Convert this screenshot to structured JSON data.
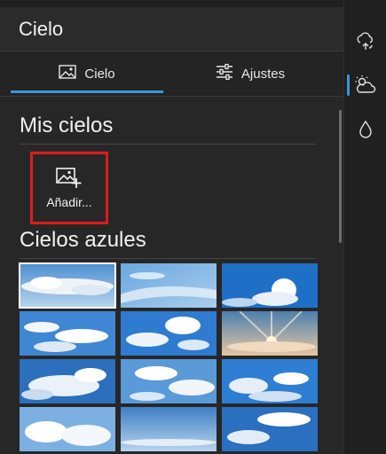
{
  "panel": {
    "title": "Cielo"
  },
  "tabs": [
    {
      "label": "Cielo",
      "icon": "image-icon",
      "active": true
    },
    {
      "label": "Ajustes",
      "icon": "sliders-icon",
      "active": false
    }
  ],
  "my_skies": {
    "title": "Mis cielos",
    "add_label": "Añadir..."
  },
  "blue_skies": {
    "title": "Cielos azules"
  },
  "rail": [
    {
      "icon": "sky-replace-icon",
      "active": false
    },
    {
      "icon": "partly-cloudy-icon",
      "active": true
    },
    {
      "icon": "water-drop-icon",
      "active": false
    }
  ],
  "colors": {
    "accent": "#3a96dd",
    "highlight_border": "#e01b1b"
  }
}
